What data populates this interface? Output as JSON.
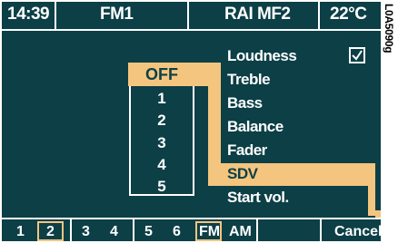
{
  "header": {
    "time": "14:39",
    "band": "FM1",
    "station": "RAI MF2",
    "temperature": "22°C"
  },
  "menu": {
    "items": [
      {
        "label": "Loudness",
        "checked": true
      },
      {
        "label": "Treble"
      },
      {
        "label": "Bass"
      },
      {
        "label": "Balance"
      },
      {
        "label": "Fader"
      },
      {
        "label": "SDV",
        "selected": true
      },
      {
        "label": "Start vol."
      }
    ]
  },
  "selector": {
    "options": [
      "OFF",
      "1",
      "2",
      "3",
      "4",
      "5"
    ],
    "selected": "OFF"
  },
  "bottom_bar": {
    "presets": [
      "1",
      "2",
      "3",
      "4",
      "5",
      "6"
    ],
    "selected_preset": "2",
    "bands": [
      "FM",
      "AM"
    ],
    "selected_band": "FM",
    "cancel": "Cancel"
  },
  "figure_code": "L0A5090g",
  "colors": {
    "screen": "#0c3f46",
    "highlight": "#f4c57f",
    "text": "#ffffff"
  }
}
